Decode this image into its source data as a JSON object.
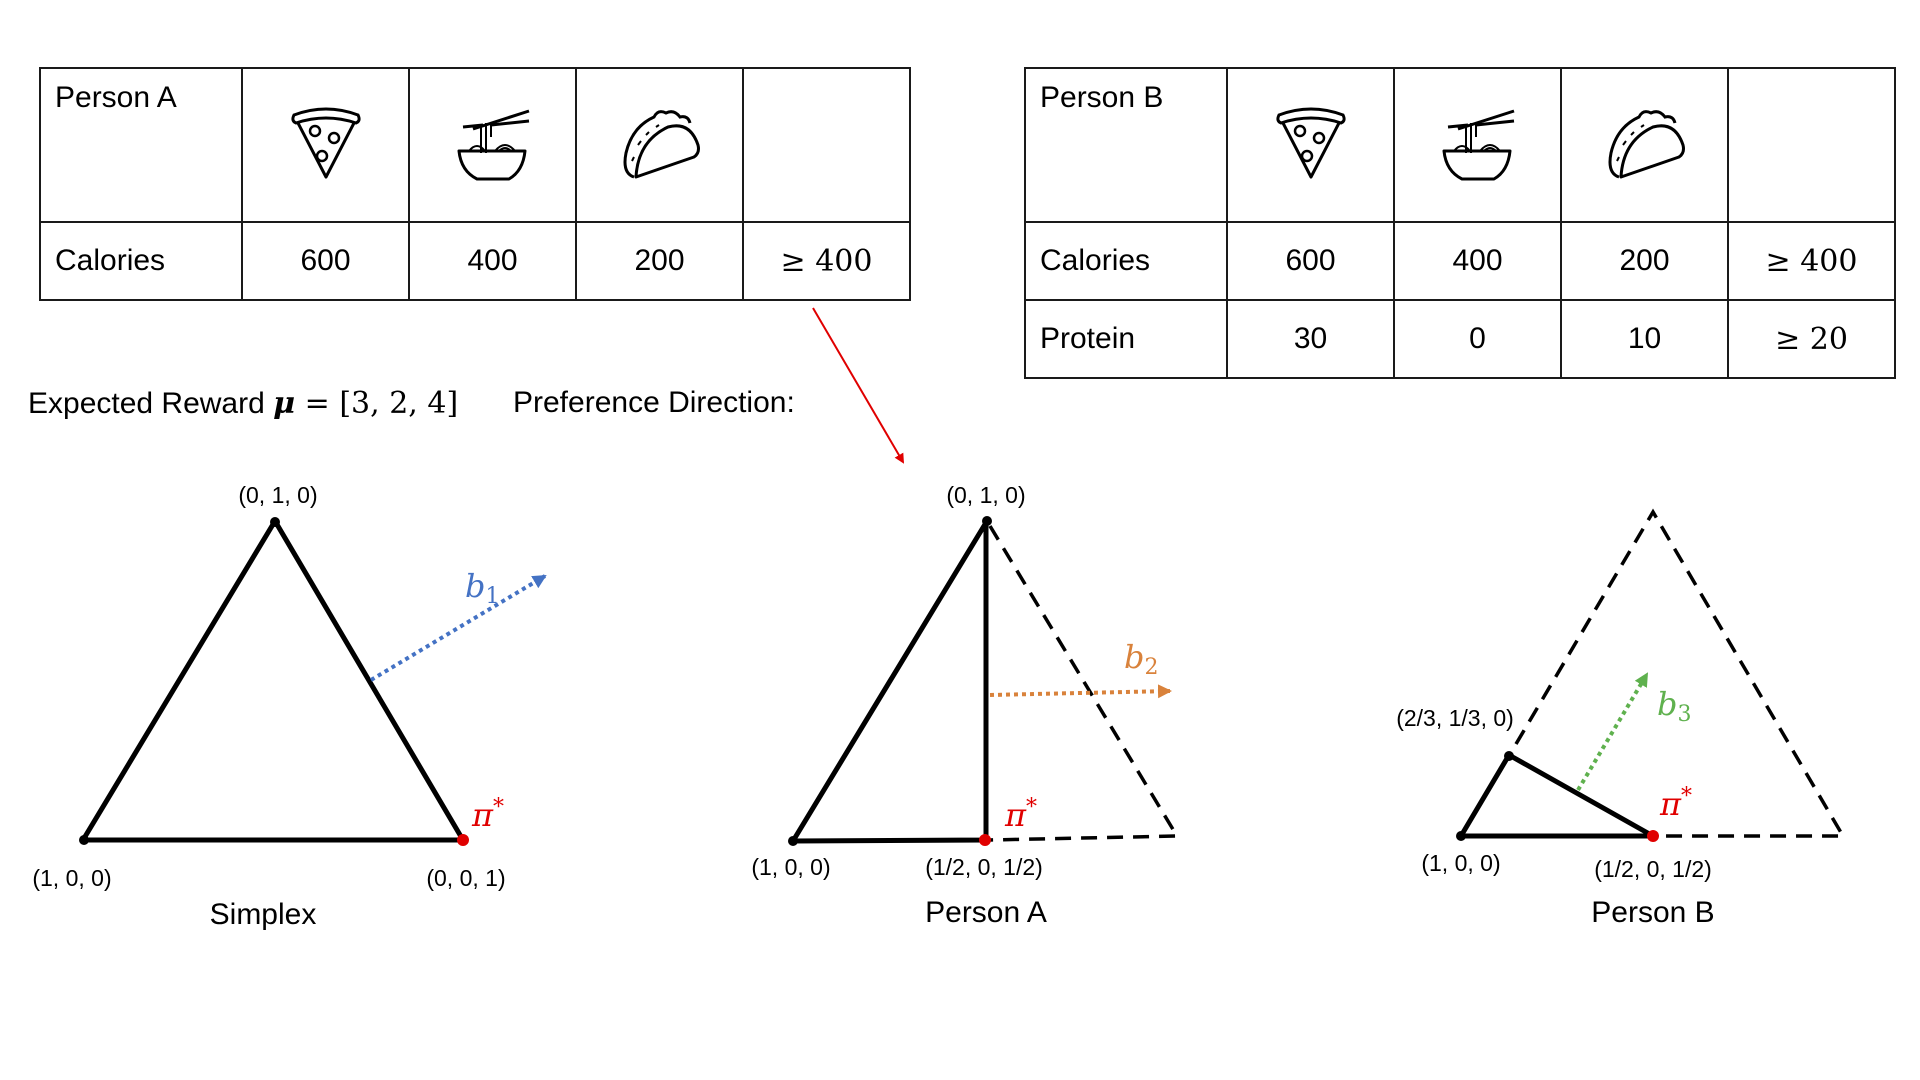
{
  "tables": [
    {
      "id": "person-a",
      "header": "Person A",
      "foods": [
        {
          "name": "pizza",
          "icon": "pizza-icon"
        },
        {
          "name": "noodles",
          "icon": "noodle-bowl-icon"
        },
        {
          "name": "taco",
          "icon": "taco-icon"
        }
      ],
      "rows": [
        {
          "label": "Calories",
          "values": [
            "600",
            "400",
            "200"
          ],
          "constraint": "≥ 400"
        }
      ]
    },
    {
      "id": "person-b",
      "header": "Person B",
      "foods": [
        {
          "name": "pizza",
          "icon": "pizza-icon"
        },
        {
          "name": "noodles",
          "icon": "noodle-bowl-icon"
        },
        {
          "name": "taco",
          "icon": "taco-icon"
        }
      ],
      "rows": [
        {
          "label": "Calories",
          "values": [
            "600",
            "400",
            "200"
          ],
          "constraint": "≥ 400"
        },
        {
          "label": "Protein",
          "values": [
            "30",
            "0",
            "10"
          ],
          "constraint": "≥ 20"
        }
      ]
    }
  ],
  "expected_reward": {
    "prefix": "Expected Reward ",
    "symbol": "μ",
    "equals": " = ",
    "value": "[3, 2, 4]"
  },
  "preference_direction_label": "Preference Direction:",
  "colors": {
    "b1": "#4472C4",
    "b2": "#D9823B",
    "b3": "#5FB14E",
    "optimum": "#E00000",
    "pointer_arrow": "#E00000",
    "line": "#000000"
  },
  "panels": [
    {
      "title": "Simplex",
      "vertex_labels": [
        "(0, 1, 0)",
        "(1, 0, 0)",
        "(0, 0, 1)"
      ],
      "direction_label": "b",
      "direction_sub": "1",
      "optimum_label": "π",
      "optimum_sup": "*"
    },
    {
      "title": "Person A",
      "vertex_labels": [
        "(0, 1, 0)",
        "(1, 0, 0)",
        "(1/2, 0, 1/2)"
      ],
      "direction_label": "b",
      "direction_sub": "2",
      "optimum_label": "π",
      "optimum_sup": "*"
    },
    {
      "title": "Person B",
      "vertex_labels": [
        "(2/3, 1/3, 0)",
        "(1, 0, 0)",
        "(1/2, 0, 1/2)"
      ],
      "direction_label": "b",
      "direction_sub": "3",
      "optimum_label": "π",
      "optimum_sup": "*"
    }
  ]
}
